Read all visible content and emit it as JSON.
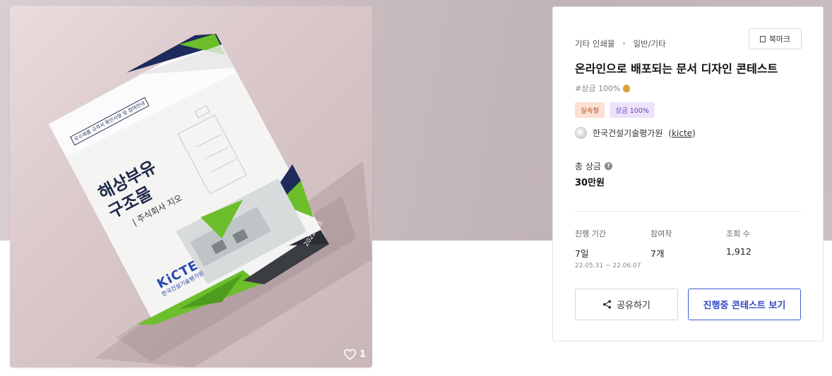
{
  "image": {
    "poster_tag": "우수제품 규격서 확인사항 및 참여안내",
    "poster_title": "해상부유\n구조물",
    "poster_subtitle": "| 주식회사 지오",
    "poster_brand": "KiCTE",
    "poster_brand_sub": "한국건설기술평가원",
    "poster_date": "2022. 03.",
    "likes": "1",
    "colors": {
      "navy": "#1f2a5c",
      "green": "#6cbf2a",
      "dark": "#3a3d42"
    }
  },
  "info": {
    "category": "기타 인쇄물",
    "subcategory": "일반/기타",
    "bookmark_label": "북마크",
    "title": "온라인으로 배포되는 문서 디자인 콘테스트",
    "hashtag": "#상금 100%",
    "badges": [
      "실속형",
      "상금 100%"
    ],
    "host_name": "한국건설기술평가원",
    "host_id": "kicte",
    "prize_label": "총 상금",
    "prize_value": "30만원",
    "stats": {
      "duration_label": "진행 기간",
      "duration_value": "7일",
      "duration_range": "22.05.31 ~ 22.06.07",
      "entries_label": "참여작",
      "entries_value": "7개",
      "views_label": "조회 수",
      "views_value": "1,912"
    },
    "share_label": "공유하기",
    "active_label": "진행중 콘테스트 보기",
    "accent_color": "#3f5bd6"
  }
}
